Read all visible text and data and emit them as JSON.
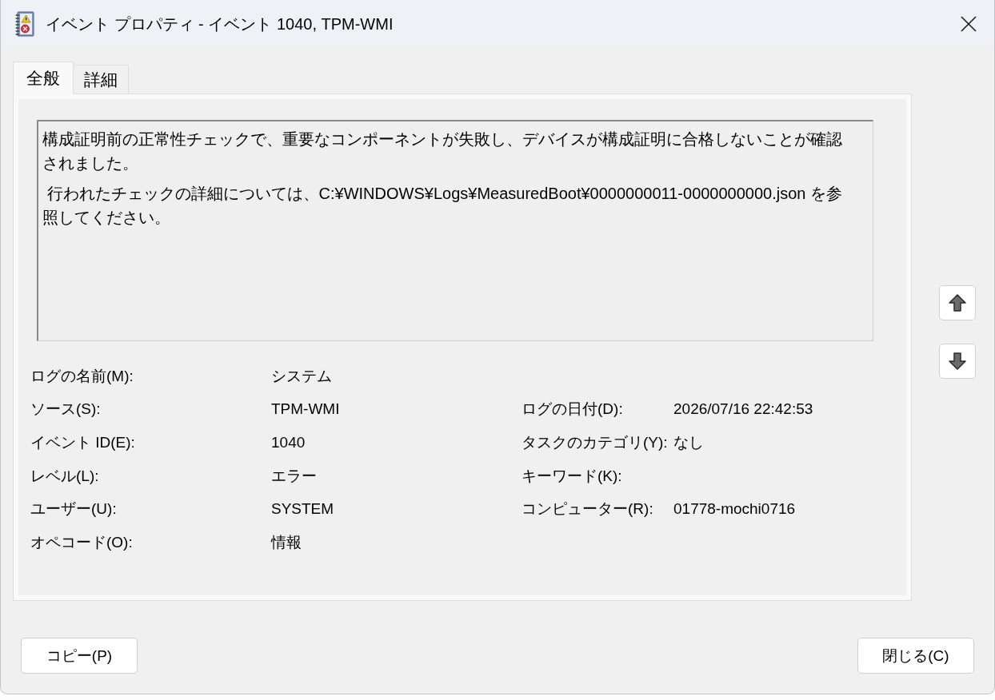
{
  "window": {
    "title": "イベント プロパティ - イベント 1040, TPM-WMI"
  },
  "tabs": [
    {
      "label": "全般",
      "selected": true
    },
    {
      "label": "詳細",
      "selected": false
    }
  ],
  "message": [
    "構成証明前の正常性チェックで、重要なコンポーネントが失敗し、デバイスが構成証明に合格しないことが確認されました。",
    " 行われたチェックの詳細については、C:¥WINDOWS¥Logs¥MeasuredBoot¥0000000011-0000000000.json を参照してください。"
  ],
  "fields_left": [
    {
      "label": "ログの名前(M):",
      "value": "システム"
    },
    {
      "label": "ソース(S):",
      "value": "TPM-WMI"
    },
    {
      "label": "イベント ID(E):",
      "value": "1040"
    },
    {
      "label": "レベル(L):",
      "value": "エラー"
    },
    {
      "label": "ユーザー(U):",
      "value": "SYSTEM"
    },
    {
      "label": "オペコード(O):",
      "value": "情報"
    }
  ],
  "fields_right": [
    {
      "label": "ログの日付(D):",
      "value": "2026/07/16 22:42:53"
    },
    {
      "label": "タスクのカテゴリ(Y):",
      "value": "なし"
    },
    {
      "label": "キーワード(K):"
    },
    {
      "label": "コンピューター(R):",
      "value": "01778-mochi0716"
    }
  ],
  "buttons": [
    "コピー(P)",
    "閉じる(C)"
  ]
}
